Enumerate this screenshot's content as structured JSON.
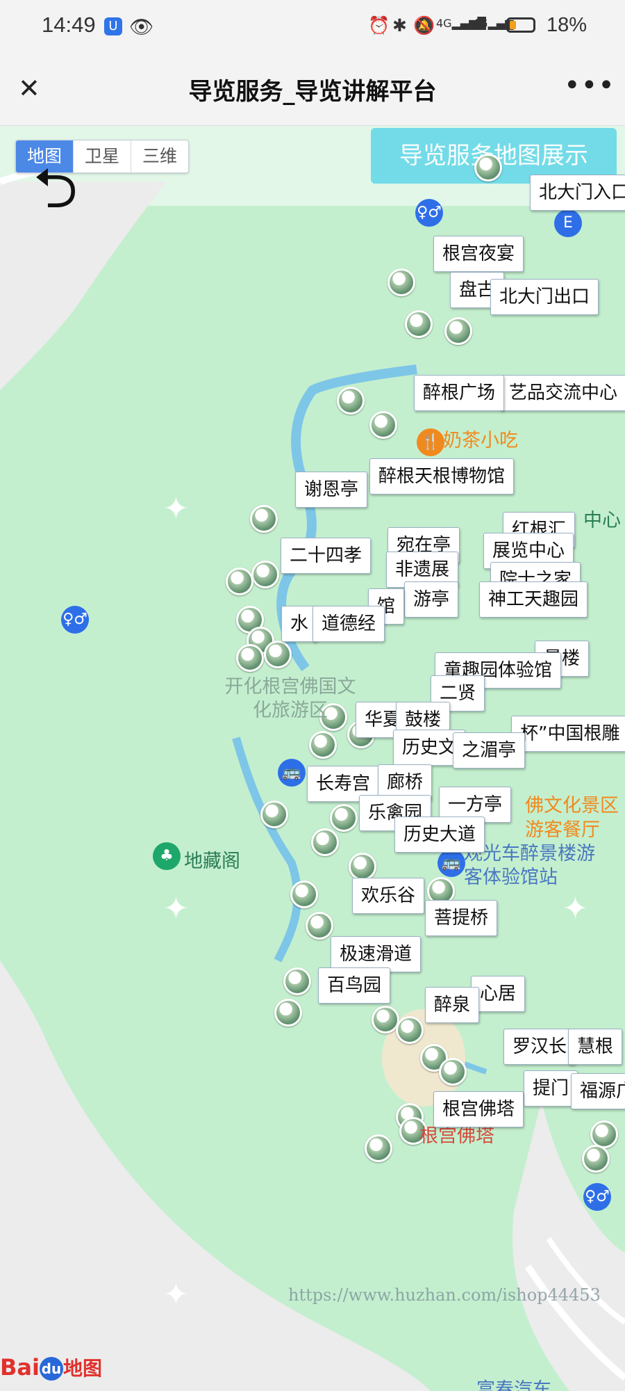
{
  "status_bar": {
    "time": "14:49",
    "battery_percent": "18%",
    "network_1": "4G",
    "network_2": "4G"
  },
  "title_bar": {
    "title": "导览服务_导览讲解平台",
    "close_icon": "close-icon",
    "more_icon": "more-icon"
  },
  "map": {
    "map_types": [
      "地图",
      "卫星",
      "三维"
    ],
    "selected_map_type": "地图",
    "show_button": "导览服务地图展示",
    "poi_labels": {
      "p1": "根宫夜宴",
      "p2": "盘古",
      "p3": "北大门出口",
      "p4": "醉根广场",
      "p5": "艺品交流中心",
      "p6": "谢恩亭",
      "p7": "醉根天根博物馆",
      "p8": "二十四孝",
      "p9": "宛在亭",
      "p10": "展览中心",
      "p11": "非遗展",
      "p12": "院士之家",
      "p13": "游亭",
      "p14": "神工天趣园",
      "p15": "道德经",
      "p16": "水",
      "p17": "馆",
      "p18": "景楼",
      "p19": "童趣园体验馆",
      "p20": "华夏",
      "p21": "鼓楼",
      "p22": "之湄亭",
      "p23": "历史文",
      "p24": "杯”中国根雕",
      "p25": "长寿宫",
      "p26": "廊桥",
      "p27": "乐禽园",
      "p28": "一方亭",
      "p29": "历史大道",
      "p30": "欢乐谷",
      "p31": "菩提桥",
      "p32": "极速滑道",
      "p33": "百鸟园",
      "p34": "醉泉",
      "p35": "心居",
      "p36": "罗汉长",
      "p37": "慧根",
      "p38": "提门",
      "p39": "福源广",
      "p40": "根宫佛塔",
      "p41": "二贤",
      "p42": "红根汇",
      "p43": "北大门入口"
    },
    "place_names": {
      "milk_tea": "奶茶小吃",
      "scenic_area": "开化根宫佛国文化旅游区",
      "dizang": "地藏阁",
      "culture_area": "佛文化景区",
      "restaurant": "游客餐厅",
      "bus_station": "观光车醉景楼游客体验馆站",
      "pagoda": "根宫佛塔",
      "center": "中心",
      "bus_bottom": "富春汽车"
    },
    "watermark": "https://www.huzhan.com/ishop44453",
    "logo": "Bai du 地图"
  }
}
